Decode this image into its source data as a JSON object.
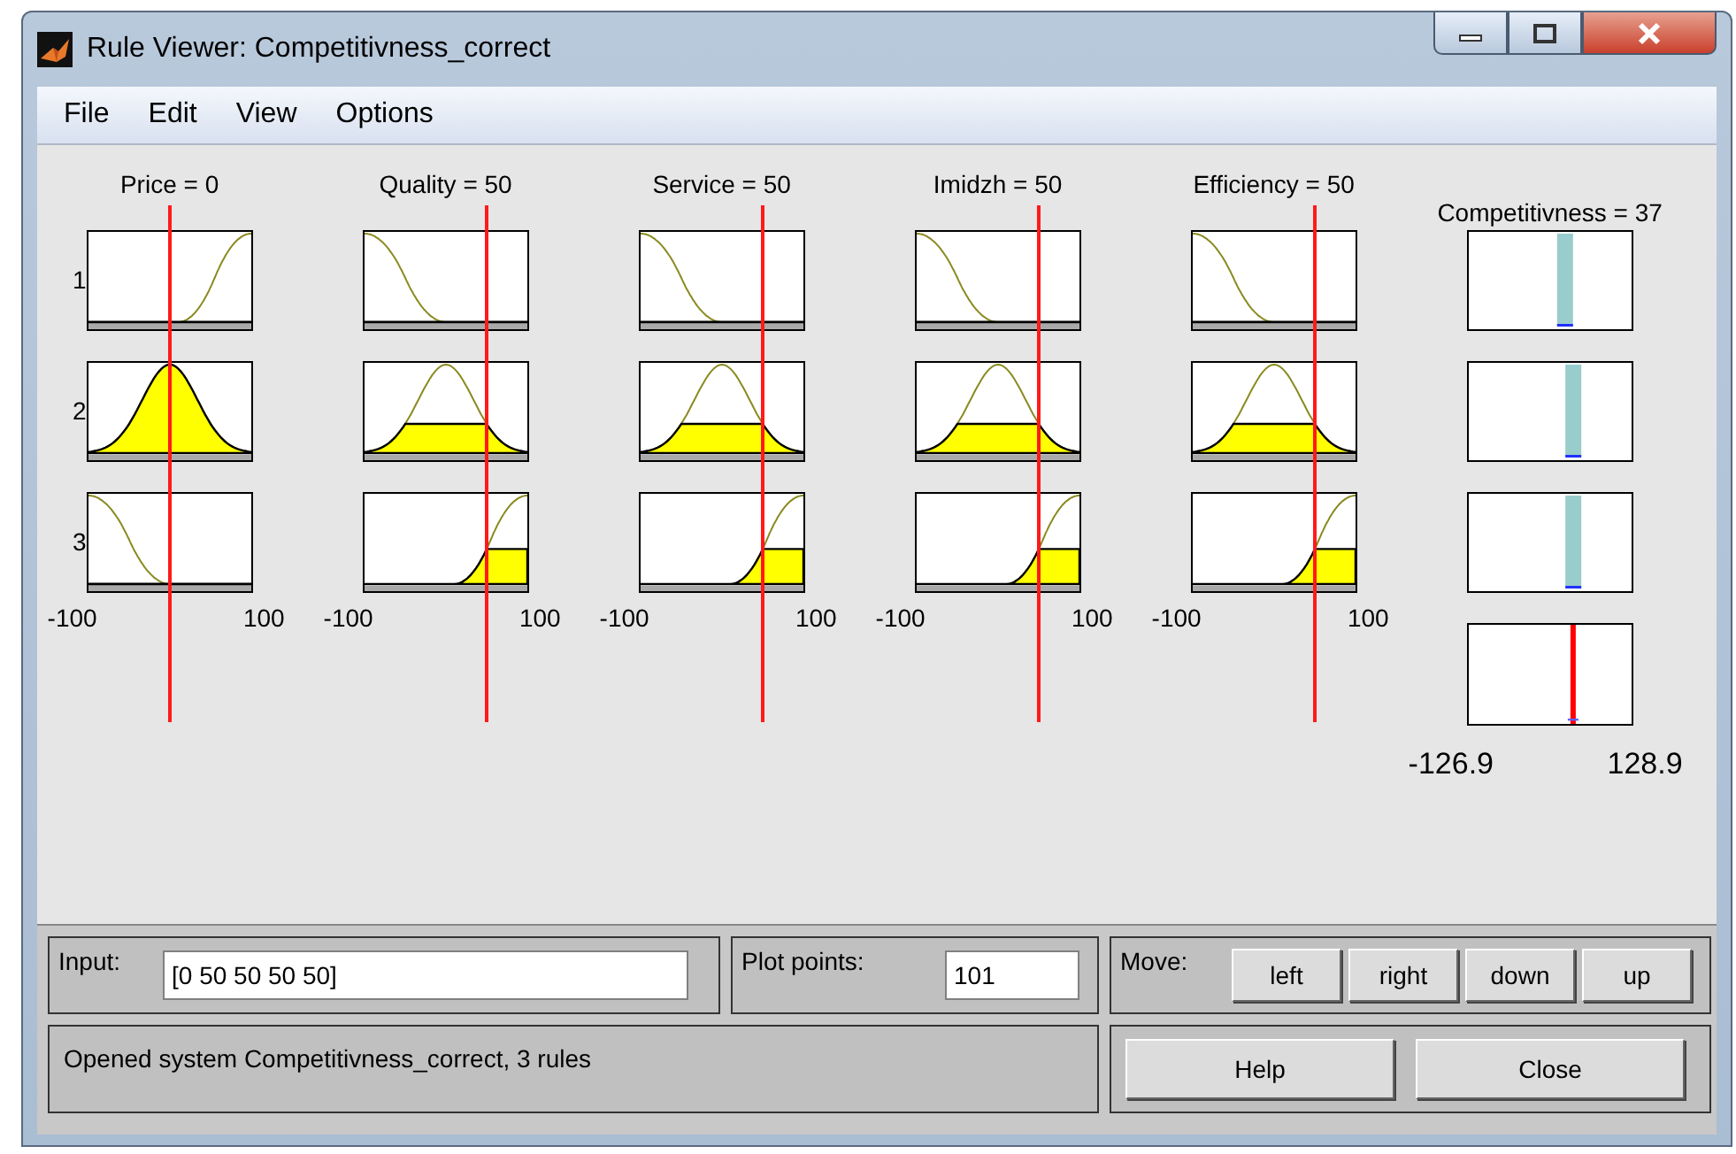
{
  "window": {
    "title": "Rule Viewer: Competitivness_correct"
  },
  "menu": [
    "File",
    "Edit",
    "View",
    "Options"
  ],
  "rule_numbers": [
    "1",
    "2",
    "3"
  ],
  "inputs": [
    {
      "label": "Price = 0",
      "range_min": "-100",
      "range_max": "100",
      "rules": [
        {
          "kind": "s"
        },
        {
          "kind": "gauss"
        },
        {
          "kind": "z"
        }
      ]
    },
    {
      "label": "Quality = 50",
      "range_min": "-100",
      "range_max": "100",
      "rules": [
        {
          "kind": "z"
        },
        {
          "kind": "gauss"
        },
        {
          "kind": "s"
        }
      ]
    },
    {
      "label": "Service = 50",
      "range_min": "-100",
      "range_max": "100",
      "rules": [
        {
          "kind": "z"
        },
        {
          "kind": "gauss"
        },
        {
          "kind": "s"
        }
      ]
    },
    {
      "label": "Imidzh = 50",
      "range_min": "-100",
      "range_max": "100",
      "rules": [
        {
          "kind": "z"
        },
        {
          "kind": "gauss"
        },
        {
          "kind": "s"
        }
      ]
    },
    {
      "label": "Efficiency = 50",
      "range_min": "-100",
      "range_max": "100",
      "rules": [
        {
          "kind": "z"
        },
        {
          "kind": "gauss"
        },
        {
          "kind": "s"
        }
      ]
    }
  ],
  "output": {
    "label": "Competitivness = 37",
    "range_min": "-126.9",
    "range_max": "128.9"
  },
  "input_field": {
    "label": "Input:",
    "value": "[0 50 50 50 50]"
  },
  "plot_points": {
    "label": "Plot points:",
    "value": "101"
  },
  "move": {
    "label": "Move:",
    "buttons": [
      "left",
      "right",
      "down",
      "up"
    ]
  },
  "status": "Opened system Competitivness_correct, 3 rules",
  "buttons": [
    "Help",
    "Close"
  ]
}
